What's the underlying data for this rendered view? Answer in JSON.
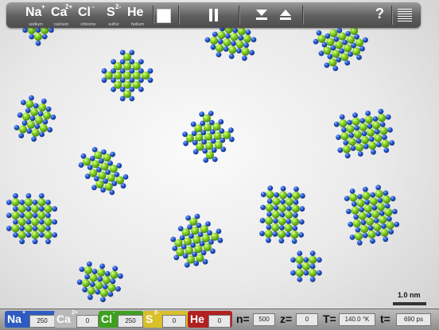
{
  "toolbar": {
    "elements": [
      {
        "symbol": "Na",
        "charge": "+",
        "name": "sodium"
      },
      {
        "symbol": "Ca",
        "charge": "2+",
        "name": "calcium"
      },
      {
        "symbol": "Cl",
        "charge": "-",
        "name": "chlorine"
      },
      {
        "symbol": "S",
        "charge": "2-",
        "name": "sulfur"
      },
      {
        "symbol": "He",
        "charge": "",
        "name": "helium"
      }
    ],
    "stop_icon": "stop-icon",
    "pause_icon": "pause-icon",
    "down_icon": "chevron-down-icon",
    "eject_icon": "eject-icon",
    "help_label": "?",
    "menu_icon": "menu-icon"
  },
  "scale": {
    "label": "1.0 nm"
  },
  "bottom": {
    "na": {
      "symbol": "Na",
      "charge": "+",
      "value": "250"
    },
    "ca": {
      "symbol": "Ca",
      "charge": "2+",
      "value": "0"
    },
    "cl": {
      "symbol": "Cl",
      "charge": "-",
      "value": "250"
    },
    "s": {
      "symbol": "S",
      "charge": "2-",
      "value": "0"
    },
    "he": {
      "symbol": "He",
      "value": "0"
    },
    "n": {
      "label": "n=",
      "value": "500"
    },
    "z": {
      "label": "z=",
      "value": "0"
    },
    "T": {
      "label": "T=",
      "value": "140.0 °K"
    },
    "t": {
      "label": "t=",
      "value": "690 ps"
    }
  },
  "colors": {
    "sodium": "#1f4fc7",
    "chlorine": "#6ac219",
    "na_chip": "#2d5bc0",
    "ca_chip": "#b9b9b9",
    "cl_chip": "#3fa020",
    "s_chip": "#d9c02b",
    "he_chip": "#b22020"
  }
}
